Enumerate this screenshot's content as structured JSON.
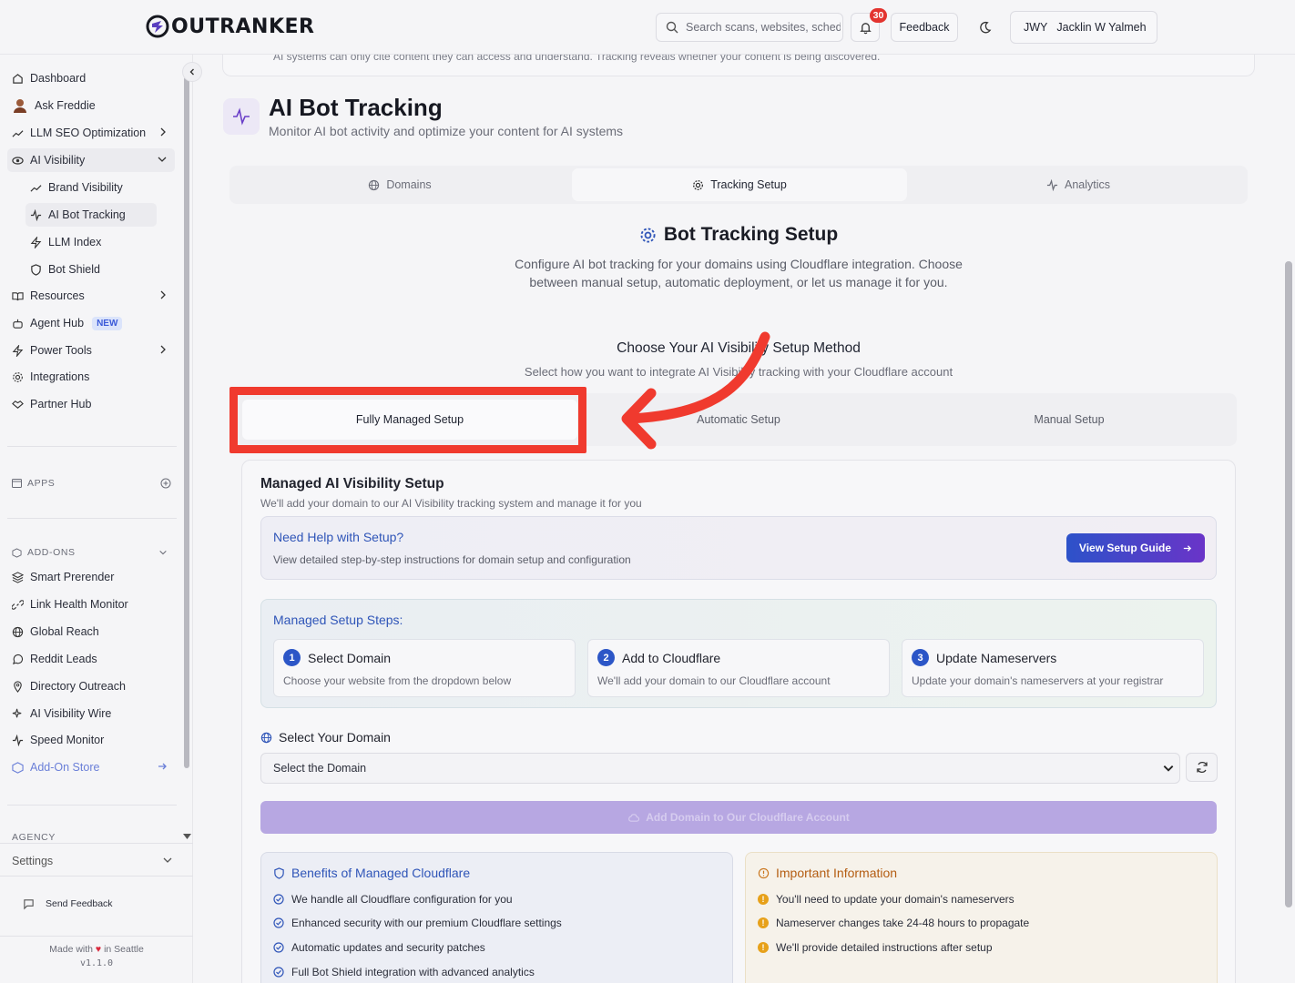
{
  "header": {
    "logo_text": "OUTRANKER",
    "search_placeholder": "Search scans, websites, schedules...",
    "notifications_count": "30",
    "feedback_label": "Feedback",
    "user_initials": "JWY",
    "user_name": "Jacklin W Yalmeh"
  },
  "sidebar": {
    "items": [
      {
        "label": "Dashboard"
      },
      {
        "label": "Ask Freddie"
      },
      {
        "label": "LLM SEO Optimization"
      },
      {
        "label": "AI Visibility"
      },
      {
        "label": "Brand Visibility"
      },
      {
        "label": "AI Bot Tracking"
      },
      {
        "label": "LLM Index"
      },
      {
        "label": "Bot Shield"
      },
      {
        "label": "Resources"
      },
      {
        "label": "Agent Hub"
      },
      {
        "label": "Power Tools"
      },
      {
        "label": "Integrations"
      },
      {
        "label": "Partner Hub"
      }
    ],
    "new_tag": "NEW",
    "apps_label": "APPS",
    "addons_label": "ADD-ONS",
    "addons": [
      {
        "label": "Smart Prerender"
      },
      {
        "label": "Link Health Monitor"
      },
      {
        "label": "Global Reach"
      },
      {
        "label": "Reddit Leads"
      },
      {
        "label": "Directory Outreach"
      },
      {
        "label": "AI Visibility Wire"
      },
      {
        "label": "Speed Monitor"
      },
      {
        "label": "Add-On Store"
      }
    ],
    "agency_label": "AGENCY",
    "settings_label": "Settings",
    "send_feedback": "Send Feedback",
    "made_with_prefix": "Made with",
    "made_with_suffix": "in Seattle",
    "version": "v1.1.0"
  },
  "main": {
    "top_notice": "AI systems can only cite content they can access and understand. Tracking reveals whether your content is being discovered.",
    "title": "AI Bot Tracking",
    "subtitle": "Monitor AI bot activity and optimize your content for AI systems",
    "tabs": [
      {
        "label": "Domains"
      },
      {
        "label": "Tracking Setup"
      },
      {
        "label": "Analytics"
      }
    ],
    "setup_title": "Bot Tracking Setup",
    "setup_desc": "Configure AI bot tracking for your domains using Cloudflare integration. Choose between manual setup, automatic deployment, or let us manage it for you.",
    "choose_title": "Choose Your AI Visibility Setup Method",
    "choose_sub": "Select how you want to integrate AI Visibility tracking with your Cloudflare account",
    "methods": [
      {
        "label": "Fully Managed Setup"
      },
      {
        "label": "Automatic Setup"
      },
      {
        "label": "Manual Setup"
      }
    ],
    "managed_title": "Managed AI Visibility Setup",
    "managed_sub": "We'll add your domain to our AI Visibility tracking system and manage it for you",
    "help_title": "Need Help with Setup?",
    "help_sub": "View detailed step-by-step instructions for domain setup and configuration",
    "guide_button": "View Setup Guide",
    "steps_title": "Managed Setup Steps:",
    "steps": [
      {
        "num": "1",
        "title": "Select Domain",
        "desc": "Choose your website from the dropdown below"
      },
      {
        "num": "2",
        "title": "Add to Cloudflare",
        "desc": "We'll add your domain to our Cloudflare account"
      },
      {
        "num": "3",
        "title": "Update Nameservers",
        "desc": "Update your domain's nameservers at your registrar"
      }
    ],
    "domain_label": "Select Your Domain",
    "domain_placeholder": "Select the Domain",
    "add_button": "Add Domain to Our Cloudflare Account",
    "benefits_title": "Benefits of Managed Cloudflare",
    "benefits": [
      "We handle all Cloudflare configuration for you",
      "Enhanced security with our premium Cloudflare settings",
      "Automatic updates and security patches",
      "Full Bot Shield integration with advanced analytics"
    ],
    "info_title": "Important Information",
    "info": [
      "You'll need to update your domain's nameservers",
      "Nameserver changes take 24-48 hours to propagate",
      "We'll provide detailed instructions after setup"
    ]
  },
  "colors": {
    "accent_blue": "#2f55b8",
    "annotation_red": "#f03a2e",
    "warning": "#e7a11a"
  }
}
